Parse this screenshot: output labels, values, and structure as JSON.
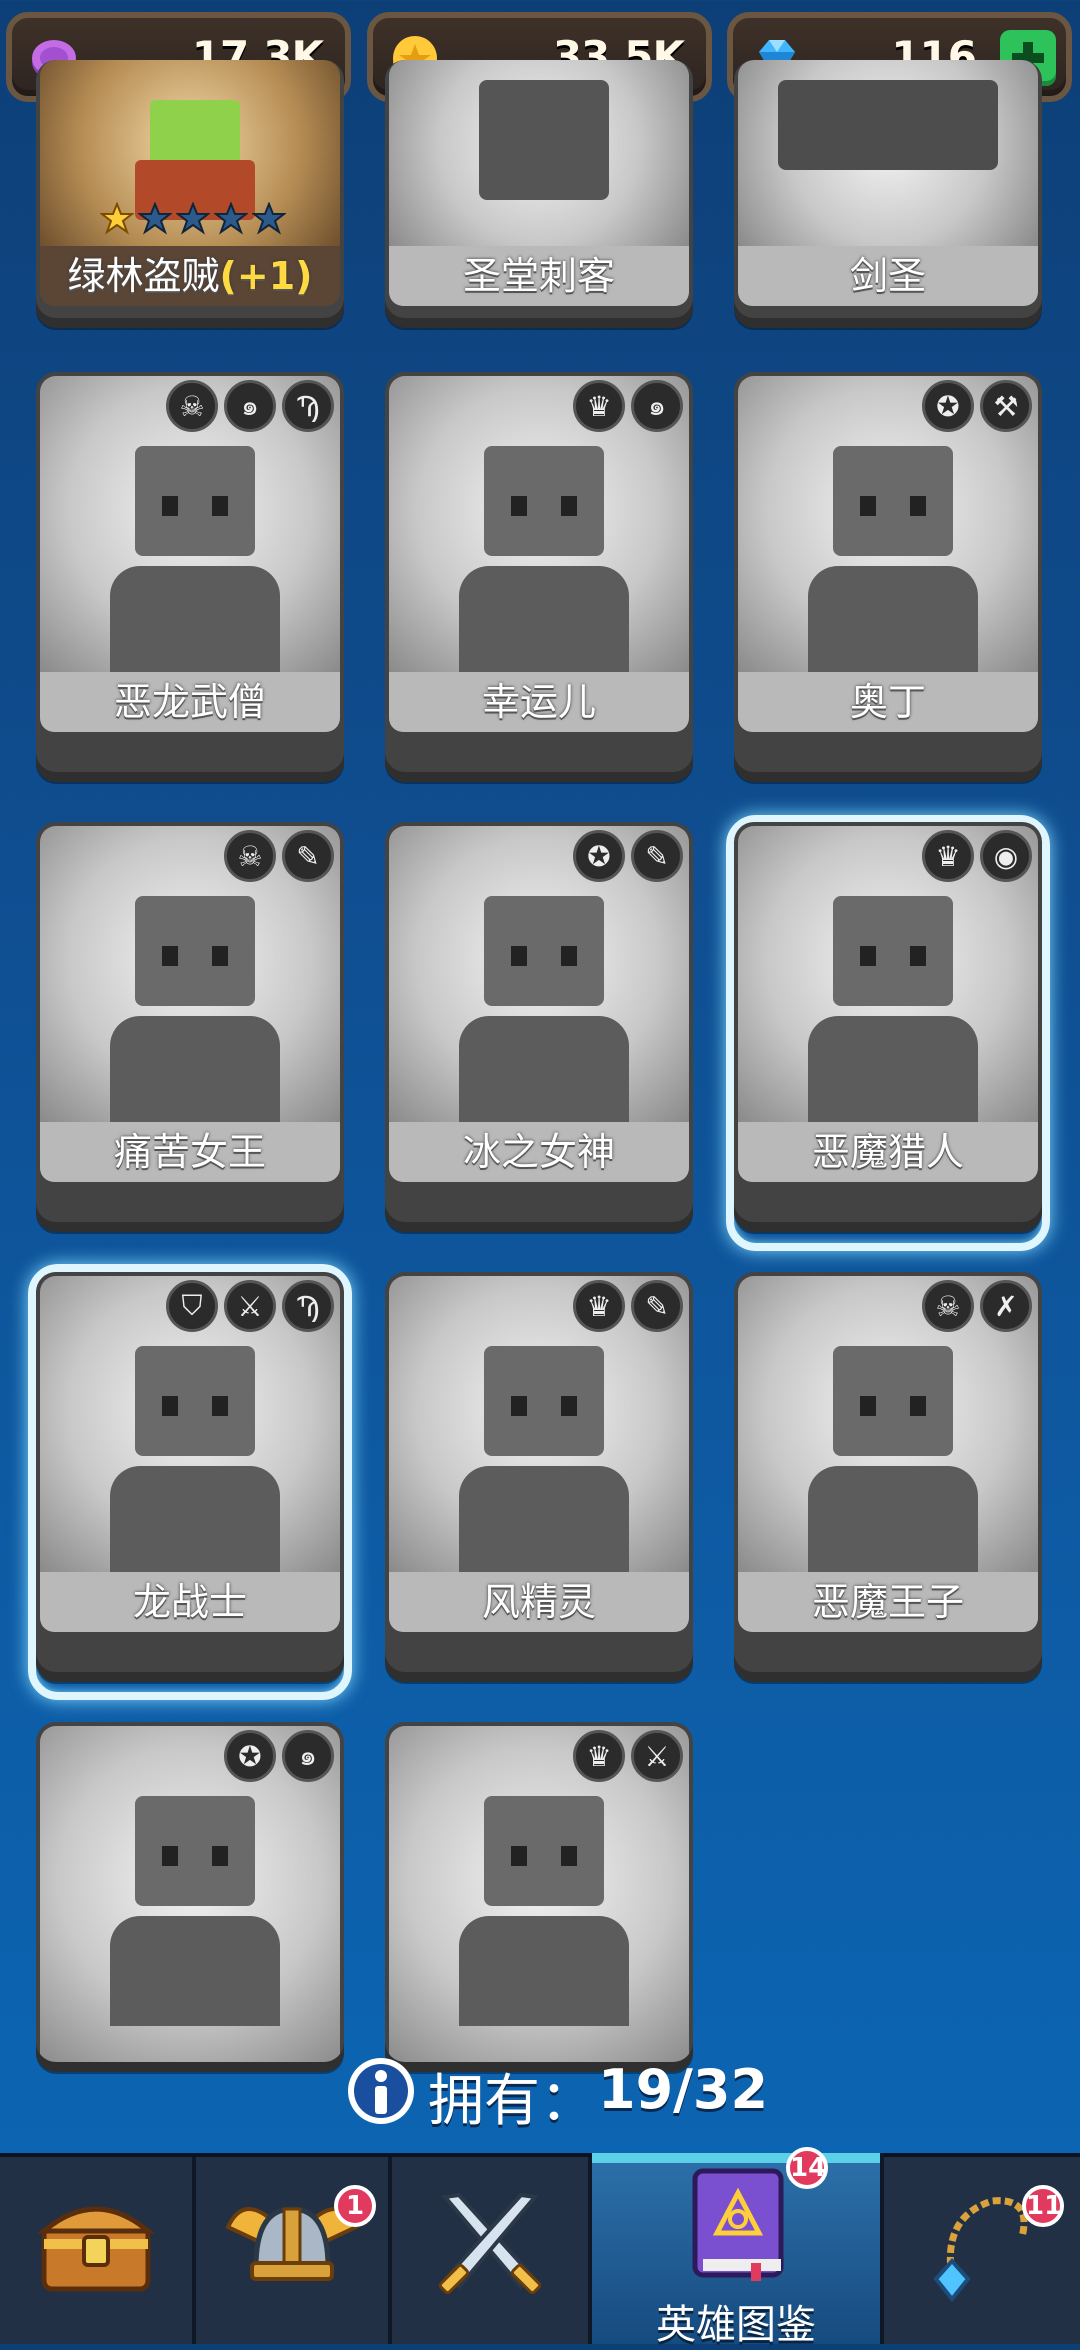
{
  "currencies": [
    {
      "name": "elixir",
      "icon": "purple-coin-icon",
      "value": "17.3K"
    },
    {
      "name": "gold",
      "icon": "gold-coin-icon",
      "value": "33.5K"
    },
    {
      "name": "gems",
      "icon": "blue-gem-icon",
      "value": "116"
    }
  ],
  "heroes_top_row": [
    {
      "name": "绿林盗贼",
      "bonus": "(+1)",
      "owned": true,
      "stars_filled": 1,
      "stars_total": 5
    },
    {
      "name": "圣堂刺客"
    },
    {
      "name": "剑圣"
    }
  ],
  "heroes": [
    {
      "name": "恶龙武僧",
      "badges": [
        "skull-icon",
        "swirl-icon",
        "dragon-icon"
      ]
    },
    {
      "name": "幸运儿",
      "badges": [
        "priestess-icon",
        "swirl-icon"
      ]
    },
    {
      "name": "奥丁",
      "badges": [
        "winged-helmet-icon",
        "hammer-icon"
      ]
    },
    {
      "name": "痛苦女王",
      "badges": [
        "skull-icon",
        "mace-icon"
      ]
    },
    {
      "name": "冰之女神",
      "badges": [
        "winged-helmet-icon",
        "mace-icon"
      ]
    },
    {
      "name": "恶魔猎人",
      "badges": [
        "priestess-icon",
        "eye-icon"
      ],
      "highlighted": true
    },
    {
      "name": "龙战士",
      "badges": [
        "knight-helmet-icon",
        "sword-icon",
        "dragon-icon"
      ],
      "highlighted": true
    },
    {
      "name": "风精灵",
      "badges": [
        "priestess-icon",
        "mace-icon"
      ]
    },
    {
      "name": "恶魔王子",
      "badges": [
        "skull-icon",
        "dagger-icon"
      ]
    },
    {
      "name": "",
      "badges": [
        "winged-helmet-icon",
        "swirl-icon"
      ]
    },
    {
      "name": "",
      "badges": [
        "priestess-icon",
        "sword-icon"
      ]
    }
  ],
  "owned": {
    "label": "拥有：",
    "value": "19/32"
  },
  "nav": {
    "tabs": [
      {
        "icon": "treasure-chest-icon",
        "badge": ""
      },
      {
        "icon": "viking-helmet-icon",
        "badge": "1"
      },
      {
        "icon": "crossed-swords-icon",
        "badge": ""
      },
      {
        "icon": "hero-book-icon",
        "badge": "14",
        "label": "英雄图鉴",
        "active": true
      },
      {
        "icon": "amulet-icon",
        "badge": "11"
      }
    ]
  },
  "colors": {
    "accent": "#5bd0e6",
    "badge_red": "#e23a5e",
    "bg": "#0f4d8f"
  }
}
